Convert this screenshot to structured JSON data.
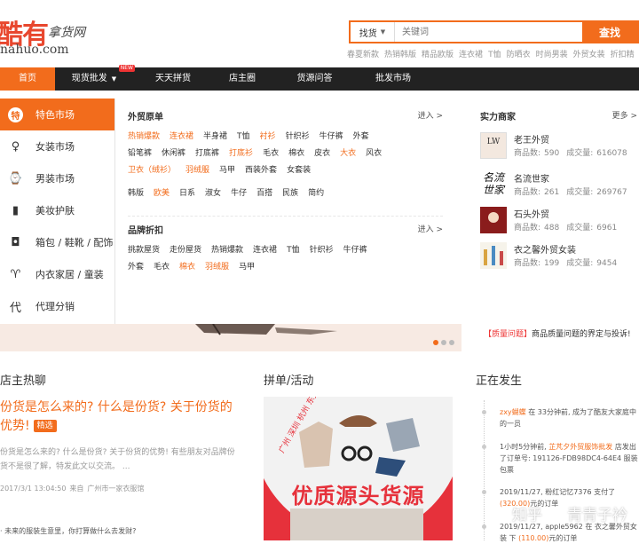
{
  "logo": {
    "cn": "酷有",
    "slogan": "拿货网",
    "domain": "nahuo.com"
  },
  "search": {
    "category": "找货",
    "placeholder": "关键词",
    "button": "查找"
  },
  "hotwords": [
    "春夏新款",
    "热销韩版",
    "精品欧版",
    "连衣裙",
    "T恤",
    "防晒衣",
    "时尚男装",
    "外贸女装",
    "折扣精"
  ],
  "nav": {
    "items": [
      {
        "label": "首页",
        "active": true
      },
      {
        "label": "现货批发",
        "badge": "NEW"
      },
      {
        "label": "天天拼货"
      },
      {
        "label": "店主圈"
      },
      {
        "label": "货源问答"
      },
      {
        "label": "批发市场"
      }
    ]
  },
  "sidebar": {
    "items": [
      {
        "label": "特色市场",
        "icon": "te-badge-icon",
        "glyph": "特",
        "active": true
      },
      {
        "label": "女装市场",
        "icon": "dress-icon",
        "glyph": "♀"
      },
      {
        "label": "男装市场",
        "icon": "watch-icon",
        "glyph": "⌚"
      },
      {
        "label": "美妆护肤",
        "icon": "lipstick-icon",
        "glyph": "▮"
      },
      {
        "label": "箱包 / 鞋靴 / 配饰",
        "icon": "bag-icon",
        "glyph": "◘"
      },
      {
        "label": "内衣家居 / 童装",
        "icon": "shirt-icon",
        "glyph": "♈"
      },
      {
        "label": "代理分销",
        "icon": "dai-badge-icon",
        "glyph": "代"
      }
    ]
  },
  "menu": {
    "section1": {
      "title": "外贸原单",
      "more": "进入 >",
      "rows": [
        [
          {
            "t": "热销爆款",
            "hl": true
          },
          {
            "t": "连衣裙",
            "hl": true
          },
          {
            "t": "半身裙"
          },
          {
            "t": "T恤"
          },
          {
            "t": "衬衫",
            "hl": true
          },
          {
            "t": "针织衫"
          },
          {
            "t": "牛仔裤"
          },
          {
            "t": "外套"
          }
        ],
        [
          {
            "t": "铅笔裤"
          },
          {
            "t": "休闲裤"
          },
          {
            "t": "打底裤"
          },
          {
            "t": "打底衫",
            "hl": true
          },
          {
            "t": "毛衣"
          },
          {
            "t": "棉衣"
          },
          {
            "t": "皮衣"
          },
          {
            "t": "大衣",
            "hl": true
          },
          {
            "t": "风衣"
          }
        ],
        [
          {
            "t": "卫衣（绒衫）",
            "hl": true
          },
          {
            "t": "羽绒服",
            "hl": true
          },
          {
            "t": "马甲"
          },
          {
            "t": "西装外套"
          },
          {
            "t": "女套装"
          }
        ],
        [
          {
            "t": "韩版"
          },
          {
            "t": "欧美",
            "hl": true
          },
          {
            "t": "日系"
          },
          {
            "t": "淑女"
          },
          {
            "t": "牛仔"
          },
          {
            "t": "百搭"
          },
          {
            "t": "民族"
          },
          {
            "t": "简约"
          }
        ]
      ]
    },
    "section2": {
      "title": "品牌折扣",
      "more": "进入 >",
      "rows": [
        [
          {
            "t": "挑款屋货"
          },
          {
            "t": "走份屋货"
          },
          {
            "t": "热销爆款"
          },
          {
            "t": "连衣裙"
          },
          {
            "t": "T恤"
          },
          {
            "t": "针织衫"
          },
          {
            "t": "牛仔裤"
          }
        ],
        [
          {
            "t": "外套"
          },
          {
            "t": "毛衣"
          },
          {
            "t": "棉衣",
            "hl": true
          },
          {
            "t": "羽绒服",
            "hl": true
          },
          {
            "t": "马甲"
          }
        ]
      ]
    }
  },
  "merchants": {
    "title": "实力商家",
    "more": "更多 >",
    "items": [
      {
        "name": "老王外贸",
        "goods_label": "商品数:",
        "goods": "590",
        "deals_label": "成交量:",
        "deals": "616078"
      },
      {
        "name": "名流世家",
        "goods_label": "商品数:",
        "goods": "261",
        "deals_label": "成交量:",
        "deals": "269767"
      },
      {
        "name": "石头外贸",
        "goods_label": "商品数:",
        "goods": "488",
        "deals_label": "成交量:",
        "deals": "6961"
      },
      {
        "name": "衣之馨外贸女装",
        "goods_label": "商品数:",
        "goods": "199",
        "deals_label": "成交量:",
        "deals": "9454"
      }
    ]
  },
  "notice": {
    "tag": "【质量问题】",
    "text": "商品质量问题的界定与投诉!"
  },
  "columns": {
    "c1": "店主热聊",
    "c2": "拼单/活动",
    "c3": "正在发生"
  },
  "chat": {
    "headline": "份货是怎么来的? 什么是份货? 关于份货的优势!",
    "badge": "精选",
    "summary": "份货是怎么来的? 什么是份货? 关于份货的优势! 有些朋友对品牌份货不是很了解，特发此文以交流。 ...",
    "date": "2017/3/1 13:04:50",
    "from_label": "来自",
    "from": "广州市一家衣服馆",
    "bullet": "· 未来的服装生意里，你打算做什么去发财?"
  },
  "poster": {
    "title": "优质源头货源",
    "cities": [
      "广州",
      "深圳",
      "杭州",
      "东大门..."
    ]
  },
  "feed": [
    {
      "user": "zxy蝴蝶",
      "text": "在 33分钟前, 成为了酷友大家庭中的一员"
    },
    {
      "time": "1小时5分钟前,",
      "user": "芷芃夕外贸服饰批发",
      "text": "店发出了订单号: 191126-FDB98DC4-64E4 服装包票"
    },
    {
      "time": "2019/11/27,",
      "user": "粉红记忆7376",
      "text": "支付了",
      "amount": "(320.00)",
      "tail": "元的订单"
    },
    {
      "time": "2019/11/27,",
      "user": "apple5962",
      "text": "在 衣之馨外贸女装 下",
      "amount": "(110.00)",
      "tail": "元的订单"
    }
  ],
  "watermark": {
    "brand": "知乎",
    "author": "青青子衿"
  },
  "colors": {
    "accent": "#f26c1c",
    "nav_bg": "#222222",
    "poster_bg": "#e6313b"
  }
}
